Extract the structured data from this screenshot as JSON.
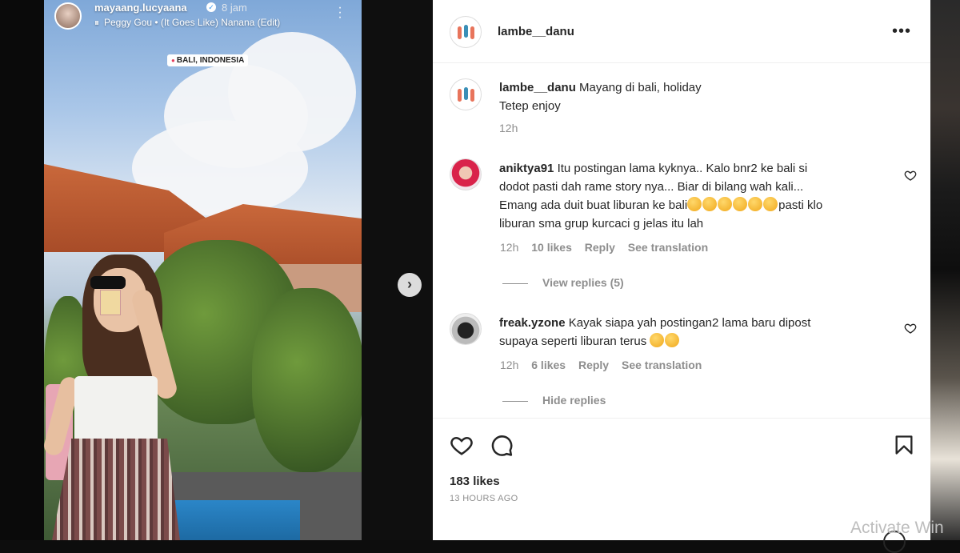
{
  "story": {
    "username": "mayaang.lucyaana",
    "time": "8 jam",
    "music": "Peggy Gou • (It Goes Like) Nanana (Edit)",
    "location": "BALI, INDONESIA"
  },
  "post": {
    "author": "lambe__danu",
    "caption_line1": "Mayang di bali, holiday",
    "caption_line2": "Tetep enjoy",
    "caption_time": "12h",
    "likes": "183 likes",
    "posted_ago": "13 HOURS AGO"
  },
  "comments": [
    {
      "username": "aniktya91",
      "text_line1": "Itu postingan lama kyknya.. Kalo bnr2 ke bali si",
      "text_line2": "dodot pasti dah rame story nya... Biar di bilang wah kali...",
      "text_line3": "Emang ada duit buat liburan ke bali",
      "text_line4a": "pasti klo",
      "text_line4": "liburan sma grup kurcaci g jelas itu lah",
      "time": "12h",
      "likes": "10 likes",
      "reply": "Reply",
      "translate": "See translation",
      "replies_toggle": "View replies (5)"
    },
    {
      "username": "freak.yzone",
      "text_line1": "Kayak siapa yah postingan2 lama baru dipost",
      "text_line2": "supaya seperti liburan terus",
      "time": "12h",
      "likes": "6 likes",
      "reply": "Reply",
      "translate": "See translation",
      "replies_toggle": "Hide replies"
    }
  ],
  "icons": {
    "like": "heart-icon",
    "comment": "comment-icon",
    "save": "bookmark-icon",
    "more": "more-options-icon",
    "next": "chevron-right-icon"
  },
  "watermark": "Activate Win"
}
